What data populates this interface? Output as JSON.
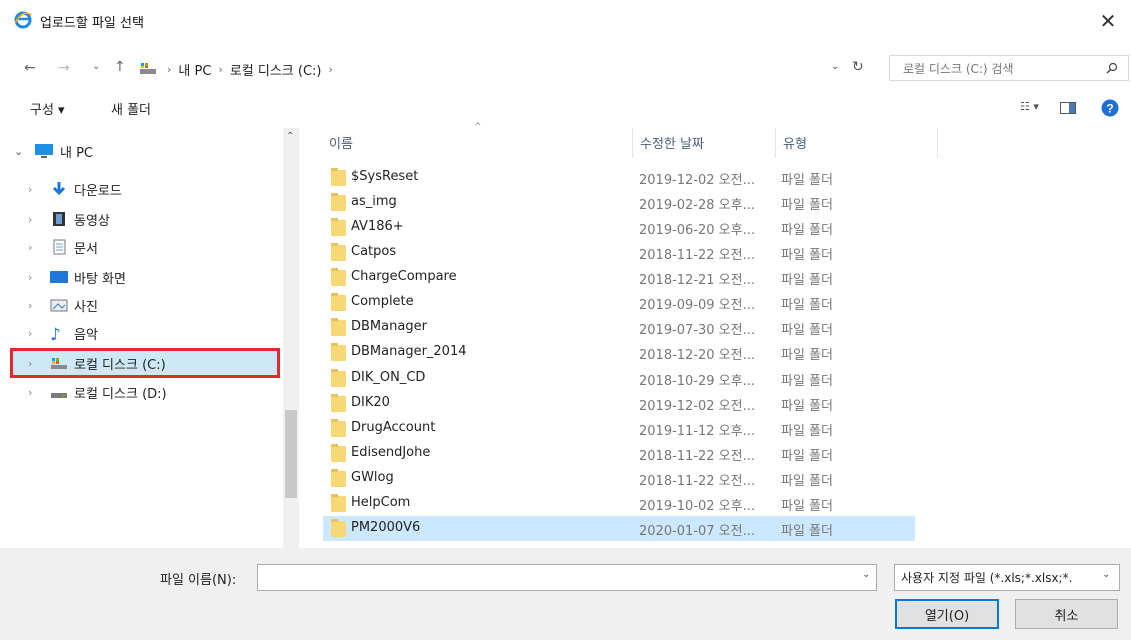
{
  "window": {
    "title": "업로드할 파일 선택"
  },
  "nav": {
    "breadcrumb": [
      "내 PC",
      "로컬 디스크 (C:)"
    ],
    "search_placeholder": "로컬 디스크 (C:) 검색"
  },
  "toolbar": {
    "organize": "구성 ▾",
    "new_folder": "새 폴더"
  },
  "tree": {
    "root": "내 PC",
    "items": [
      "다운로드",
      "동영상",
      "문서",
      "바탕 화면",
      "사진",
      "음악",
      "로컬 디스크 (C:)",
      "로컬 디스크 (D:)"
    ]
  },
  "columns": {
    "name": "이름",
    "date": "수정한 날짜",
    "type": "유형"
  },
  "files": [
    {
      "name": "$SysReset",
      "date": "2019-12-02 오전...",
      "type": "파일 폴더"
    },
    {
      "name": "as_img",
      "date": "2019-02-28 오후...",
      "type": "파일 폴더"
    },
    {
      "name": "AV186+",
      "date": "2019-06-20 오후...",
      "type": "파일 폴더"
    },
    {
      "name": "Catpos",
      "date": "2018-11-22 오전...",
      "type": "파일 폴더"
    },
    {
      "name": "ChargeCompare",
      "date": "2018-12-21 오전...",
      "type": "파일 폴더"
    },
    {
      "name": "Complete",
      "date": "2019-09-09 오전...",
      "type": "파일 폴더"
    },
    {
      "name": "DBManager",
      "date": "2019-07-30 오전...",
      "type": "파일 폴더"
    },
    {
      "name": "DBManager_2014",
      "date": "2018-12-20 오전...",
      "type": "파일 폴더"
    },
    {
      "name": "DIK_ON_CD",
      "date": "2018-10-29 오후...",
      "type": "파일 폴더"
    },
    {
      "name": "DIK20",
      "date": "2019-12-02 오전...",
      "type": "파일 폴더"
    },
    {
      "name": "DrugAccount",
      "date": "2019-11-12 오후...",
      "type": "파일 폴더"
    },
    {
      "name": "EdisendJohe",
      "date": "2018-11-22 오전...",
      "type": "파일 폴더"
    },
    {
      "name": "GWlog",
      "date": "2018-11-22 오전...",
      "type": "파일 폴더"
    },
    {
      "name": "HelpCom",
      "date": "2019-10-02 오후...",
      "type": "파일 폴더"
    },
    {
      "name": "PM2000V6",
      "date": "2020-01-07 오전...",
      "type": "파일 폴더"
    }
  ],
  "footer": {
    "filename_label": "파일 이름(N):",
    "filename_value": "",
    "filter": "사용자 지정 파일 (*.xls;*.xlsx;*.",
    "open": "열기(O)",
    "cancel": "취소"
  }
}
